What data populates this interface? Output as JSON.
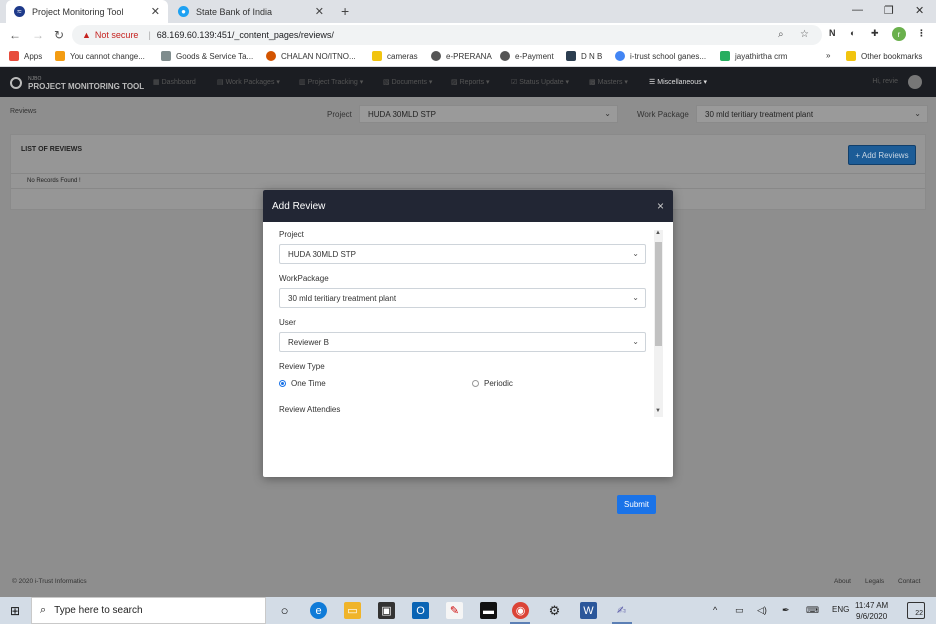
{
  "browser": {
    "tabs": [
      {
        "title": "Project Monitoring Tool",
        "active": true
      },
      {
        "title": "State Bank of India",
        "active": false
      }
    ],
    "new_tab_glyph": "+",
    "address": {
      "warning": "Not secure",
      "separator": "|",
      "url": "68.169.60.139:451/_content_pages/reviews/"
    },
    "profile_initial": "r",
    "extension_label": "N",
    "bookmarks": [
      {
        "label": "Apps",
        "color": "#e74c3c"
      },
      {
        "label": "You cannot change...",
        "color": "#f39c12"
      },
      {
        "label": "Goods & Service Ta...",
        "color": "#7f8c8d"
      },
      {
        "label": "CHALAN NO/ITNO...",
        "color": "#d35400"
      },
      {
        "label": "cameras",
        "color": "#f1c40f"
      },
      {
        "label": "e-PRERANA",
        "color": "#555555"
      },
      {
        "label": "e-Payment",
        "color": "#555555"
      },
      {
        "label": "D N B",
        "color": "#2c3e50"
      },
      {
        "label": "i-trust school ganes...",
        "color": "#4285f4"
      },
      {
        "label": "jayathirtha crm",
        "color": "#27ae60"
      }
    ],
    "bookmarks_overflow": "»",
    "other_bookmarks": "Other bookmarks"
  },
  "app": {
    "brand_small": "NJBO",
    "brand_name": "PROJECT MONITORING TOOL",
    "menu": [
      {
        "label": "Dashboard"
      },
      {
        "label": "Work Packages ▾"
      },
      {
        "label": "Project Tracking ▾"
      },
      {
        "label": "Documents ▾"
      },
      {
        "label": "Reports ▾"
      },
      {
        "label": "Status Update ▾"
      },
      {
        "label": "Masters ▾"
      },
      {
        "label": "Miscellaneous ▾"
      }
    ],
    "greeting": "Hi, revie",
    "breadcrumb": "Reviews",
    "filter_project_label": "Project",
    "filter_project_value": "HUDA 30MLD STP",
    "filter_wp_label": "Work Package",
    "filter_wp_value": "30 mld teritiary treatment plant",
    "list_title": "LIST OF REVIEWS",
    "add_button": "+ Add Reviews",
    "no_records": "No Records Found !",
    "footer_copy": "© 2020 i-Trust Informatics",
    "footer_links": [
      "About",
      "Legals",
      "Contact"
    ]
  },
  "modal": {
    "title": "Add Review",
    "close": "×",
    "project_label": "Project",
    "project_value": "HUDA 30MLD STP",
    "wp_label": "WorkPackage",
    "wp_value": "30 mld teritiary treatment plant",
    "user_label": "User",
    "user_value": "Reviewer B",
    "review_type_label": "Review Type",
    "review_type_options": [
      {
        "label": "One Time",
        "selected": true
      },
      {
        "label": "Periodic",
        "selected": false
      }
    ],
    "attendees_label": "Review Attendies",
    "submit": "Submit"
  },
  "taskbar": {
    "search_placeholder": "Type here to search",
    "language": "ENG",
    "time": "11:47 AM",
    "date": "9/6/2020",
    "notification_count": "22"
  },
  "colors": {
    "accent": "#1a73e8",
    "modal_header": "#222634",
    "app_nav": "#1b1d22",
    "not_secure": "#c5221f"
  }
}
